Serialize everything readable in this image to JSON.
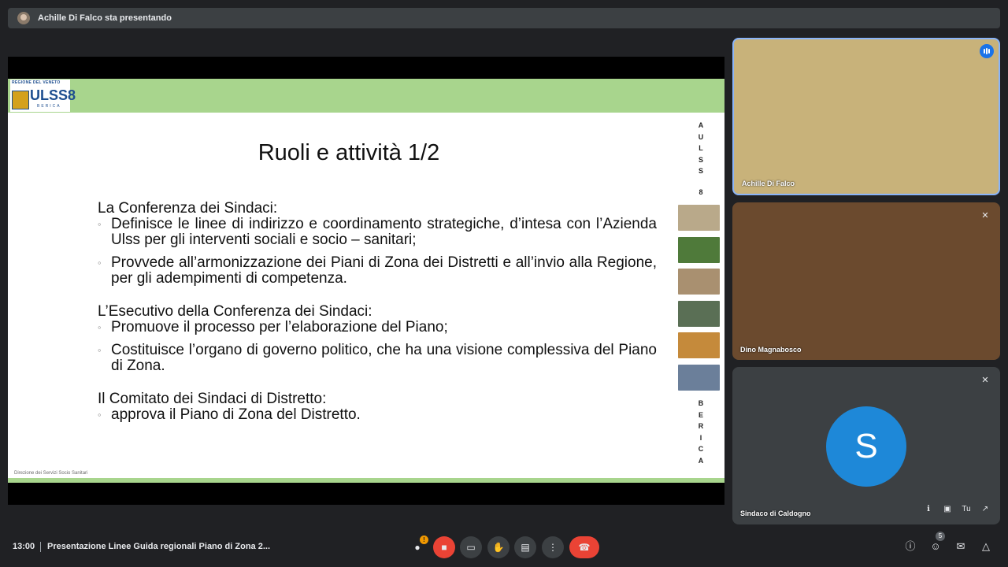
{
  "top_bar": {
    "presenting_text": "Achille Di Falco sta presentando"
  },
  "slide": {
    "logo": {
      "region": "REGIONE DEL VENETO",
      "name": "ULSS8",
      "sub": "BERICA"
    },
    "title": "Ruoli e attività 1/2",
    "vertical_top": [
      "A",
      "U",
      "L",
      "S",
      "S",
      "",
      "8"
    ],
    "vertical_bottom": [
      "B",
      "E",
      "R",
      "I",
      "C",
      "A"
    ],
    "sections": [
      {
        "heading": "La Conferenza dei Sindaci:",
        "bullets": [
          "Definisce le  linee di indirizzo e coordinamento strategiche, d’intesa con l’Azienda Ulss per gli interventi sociali e socio – sanitari;",
          "Provvede all’armonizzazione dei Piani di Zona dei Distretti e all’invio alla Regione, per gli adempimenti di competenza."
        ]
      },
      {
        "heading": "L’Esecutivo della Conferenza dei Sindaci:",
        "bullets": [
          "Promuove il processo per l’elaborazione del Piano;",
          "Costituisce l’organo di governo politico, che ha una visione complessiva del Piano di Zona."
        ]
      },
      {
        "heading": "Il Comitato dei Sindaci di Distretto:",
        "bullets": [
          "approva il Piano di Zona del Distretto."
        ]
      }
    ],
    "footer": "Direzione dei Servizi Socio Sanitari",
    "thumb_colors": [
      "#b9a98a",
      "#4f7a3a",
      "#a99070",
      "#5a6f55",
      "#c58a3b",
      "#6b7f9a"
    ]
  },
  "participants": [
    {
      "name": "Achille Di Falco",
      "speaking": true
    },
    {
      "name": "Dino Magnabosco",
      "muted": true
    },
    {
      "name": "Sindaco di Caldogno",
      "initial": "S",
      "muted": true,
      "self_label": "Tu"
    }
  ],
  "bottom_bar": {
    "time": "13:00",
    "meeting_title": "Presentazione Linee Guida regionali Piano di Zona 2...",
    "mic_badge": "!",
    "people_count": "5",
    "colors": {
      "end_call": "#ea4335",
      "warning": "#f29900",
      "accent": "#1a73e8"
    }
  }
}
